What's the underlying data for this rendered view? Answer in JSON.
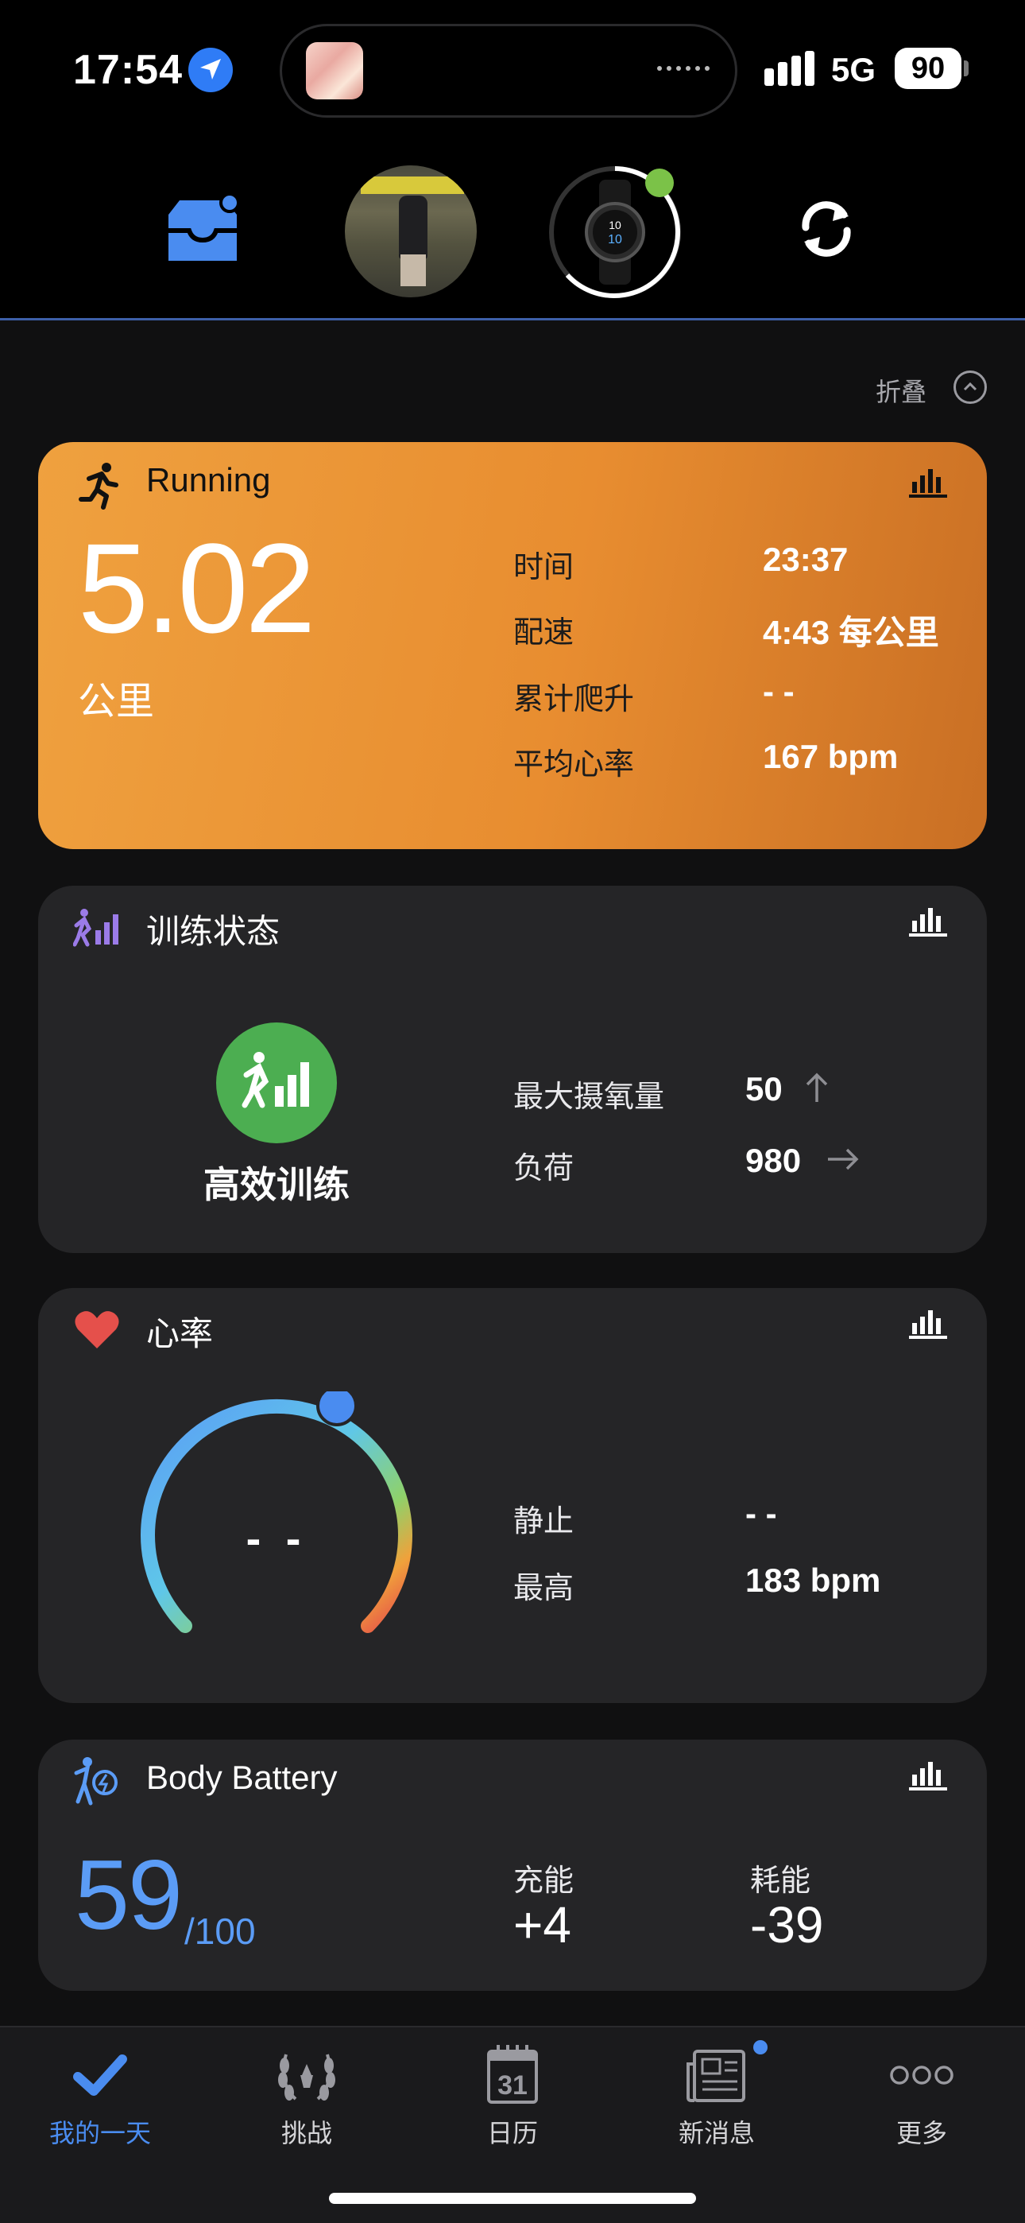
{
  "status_bar": {
    "time": "17:54",
    "network": "5G",
    "battery": "90"
  },
  "header": {
    "collapse_label": "折叠"
  },
  "running": {
    "title": "Running",
    "distance": "5.02",
    "distance_unit": "公里",
    "stats": [
      {
        "label": "时间",
        "value": "23:37"
      },
      {
        "label": "配速",
        "value": "4:43 每公里"
      },
      {
        "label": "累计爬升",
        "value": "- -"
      },
      {
        "label": "平均心率",
        "value": "167 bpm"
      }
    ]
  },
  "training_status": {
    "title": "训练状态",
    "status": "高效训练",
    "stats": [
      {
        "label": "最大摄氧量",
        "value": "50",
        "trend": "up"
      },
      {
        "label": "负荷",
        "value": "980",
        "trend": "right"
      }
    ]
  },
  "heart_rate": {
    "title": "心率",
    "current": "- -",
    "stats": [
      {
        "label": "静止",
        "value": "- -"
      },
      {
        "label": "最高",
        "value": "183 bpm"
      }
    ]
  },
  "body_battery": {
    "title": "Body Battery",
    "value": "59",
    "max": "/100",
    "charged_label": "充能",
    "charged_value": "+4",
    "drained_label": "耗能",
    "drained_value": "-39"
  },
  "tabbar": {
    "items": [
      {
        "label": "我的一天",
        "icon": "checkmark-icon",
        "active": true
      },
      {
        "label": "挑战",
        "icon": "laurel-icon",
        "active": false
      },
      {
        "label": "日历",
        "icon": "calendar-icon",
        "active": false,
        "date": "31"
      },
      {
        "label": "新消息",
        "icon": "newspaper-icon",
        "active": false,
        "badge": true
      },
      {
        "label": "更多",
        "icon": "more-icon",
        "active": false
      }
    ]
  },
  "colors": {
    "accent": "#4a8cf0",
    "running_card": "#e88d30",
    "training_green": "#4cae51",
    "heart_red": "#e5504b",
    "battery_blue": "#5b9cf6"
  }
}
